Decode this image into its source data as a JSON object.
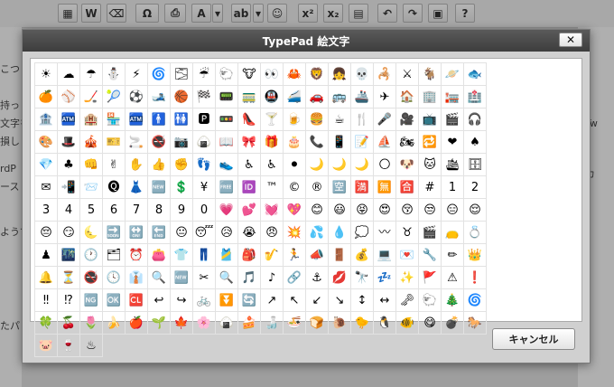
{
  "toolbar": {
    "buttons": [
      {
        "name": "paste-text-icon",
        "glyph": "▦"
      },
      {
        "name": "paste-word-icon",
        "glyph": "W"
      },
      {
        "name": "remove-format-icon",
        "glyph": "⌫"
      },
      {
        "name": "special-chars-icon",
        "glyph": "Ω"
      },
      {
        "name": "print-icon",
        "glyph": "⎙"
      },
      {
        "name": "text-color-icon",
        "glyph": "A"
      },
      {
        "name": "text-color-dropdown-icon",
        "glyph": "▾"
      },
      {
        "name": "spellcheck-icon",
        "glyph": "ab"
      },
      {
        "name": "spellcheck-dropdown-icon",
        "glyph": "▾"
      },
      {
        "name": "emoticon-icon",
        "glyph": "☺"
      },
      {
        "name": "superscript-icon",
        "glyph": "x²"
      },
      {
        "name": "subscript-icon",
        "glyph": "x₂"
      },
      {
        "name": "media-icon",
        "glyph": "▤"
      },
      {
        "name": "undo-icon",
        "glyph": "↶"
      },
      {
        "name": "redo-icon",
        "glyph": "↷"
      },
      {
        "name": "insert-more-icon",
        "glyph": "▣"
      },
      {
        "name": "help-icon",
        "glyph": "?"
      }
    ]
  },
  "background": {
    "left_fragments": [
      "こつ",
      "持っ",
      "文字を",
      "損し",
      "rdP",
      "ース",
      "ようで",
      "たパ"
    ],
    "right_fragments": [
      "Tw",
      "カ"
    ]
  },
  "dialog": {
    "title": "TypePad 絵文字",
    "close_label": "✕",
    "cancel_label": "キャンセル"
  },
  "emoji_rows": [
    [
      "☀",
      "☁",
      "☂",
      "⛄",
      "⚡",
      "🌀",
      "🌫",
      "☔",
      "🐑",
      "🐮",
      "👀",
      "🦀",
      "🦁",
      "👧",
      "💀",
      "🦂",
      "⚔",
      "🐐",
      "🪐",
      "🐟",
      "🍊",
      "⚾",
      "🏒"
    ],
    [
      "🎾",
      "⚽",
      "🎿",
      "🏀",
      "🏁",
      "📟",
      "🚃",
      "🚇",
      "🚄",
      "🚗",
      "🚌",
      "🚢",
      "✈",
      "🏠",
      "🏢",
      "🏣",
      "🏥",
      "🏦",
      "🏧",
      "🏨",
      "🏪"
    ],
    [
      "🏧",
      "🚹",
      "🚻",
      "🅿",
      "🚥",
      "👠",
      "🍸",
      "🍺",
      "🍔",
      "☕",
      "🍴",
      "🎤",
      "🎥",
      "📺",
      "🎬",
      "🎧",
      "🎨",
      "🎩",
      "🎪",
      "🎫",
      "🚬",
      "🚭",
      "📷",
      "🍙"
    ],
    [
      "📖",
      "🎀",
      "🎁",
      "🎂",
      "📞",
      "📱",
      "📝",
      "⛵",
      "🏍",
      "🔁",
      "❤",
      "♠",
      "💎",
      "♣",
      "👊",
      "✌",
      "✋",
      "👍",
      "✊",
      "👣",
      "👟"
    ],
    [
      "♿",
      "♿",
      "⚫",
      "🌙",
      "🌙",
      "🌙",
      "🌕",
      "🐶",
      "🐱",
      "🛳",
      "🗄",
      "✉",
      "📲",
      "📨",
      "🅠",
      "👗",
      "🆕",
      "💲",
      "¥",
      "🆓",
      "🆔"
    ],
    [
      "™",
      "©",
      "®",
      "🈳",
      "🈵",
      "🈚",
      "🈴",
      "#",
      "1",
      "2",
      "3",
      "4",
      "5",
      "6",
      "7",
      "8",
      "9",
      "0",
      "💗",
      "💕",
      "💓",
      "💖"
    ],
    [
      "😊",
      "😃",
      "😝",
      "😍",
      "😚",
      "😒",
      "😑",
      "😌",
      "😔",
      "😏",
      "🌜",
      "🔜",
      "🔛",
      "🔚",
      "😐",
      "😴",
      "😥",
      "😭",
      "😠",
      "💥"
    ],
    [
      "💦",
      "💧",
      "💭",
      "〰",
      "♉",
      "🎬",
      "👝",
      "💍",
      "♟",
      "🌃",
      "🕐",
      "🗂",
      "⏰",
      "👛",
      "👕",
      "👖",
      "🎽",
      "🎒",
      "🎷",
      "🏃",
      "📣"
    ],
    [
      "🚪",
      "💰",
      "💻",
      "💌",
      "🔧",
      "✏",
      "👑",
      "🔔",
      "⏳",
      "🚭",
      "🕓",
      "👔",
      "🔍",
      "🆕",
      "✂",
      "🔍",
      "🎵",
      "♪",
      "🔗",
      "⚓",
      "💋",
      "🔭",
      "💤",
      "✨",
      "🚩"
    ],
    [
      "⚠",
      "❗",
      "‼",
      "⁉",
      "🆖",
      "🆗",
      "🆑",
      "↩",
      "↪",
      "🚲",
      "⏬",
      "🔄",
      "↗",
      "↖",
      "↙",
      "↘",
      "↕",
      "↔",
      "🗝",
      "🐑",
      "🎄",
      "🌀",
      "🍀"
    ],
    [
      "🍒",
      "🌷",
      "🍌",
      "🍎",
      "🌱",
      "🍁",
      "🌸",
      "🍙",
      "🍰",
      "🍶",
      "🍜",
      "🍞",
      "🐌",
      "🐤",
      "🐧",
      "🐠",
      "😋",
      "💣",
      "🐎",
      "🐷",
      "🍷",
      "♨"
    ]
  ]
}
